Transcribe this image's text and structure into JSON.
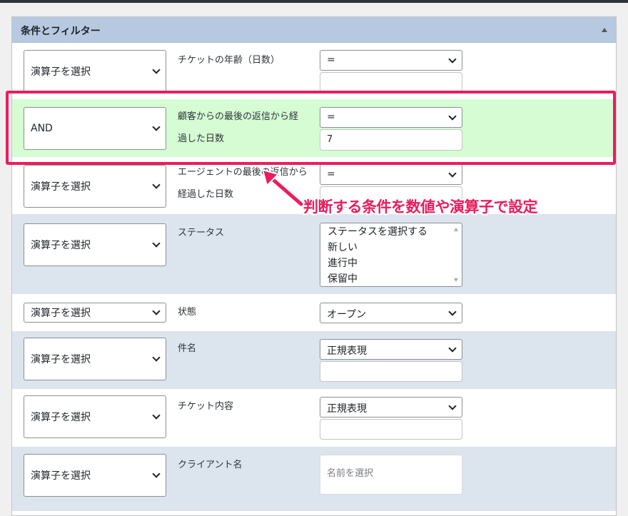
{
  "panel": {
    "title": "条件とフィルター"
  },
  "operator_placeholder": "演算子を選択",
  "rows": [
    {
      "operator": "演算子を選択",
      "label": "チケットの年齢（日数）",
      "comparator": "=",
      "value": ""
    },
    {
      "operator": "AND",
      "label_line1": "顧客からの最後の返信から経",
      "label_line2": "過した日数",
      "comparator": "=",
      "value": "7"
    },
    {
      "operator": "演算子を選択",
      "label_line1": "エージェントの最後の返信から",
      "label_line2": "経過した日数",
      "comparator": "=",
      "value": ""
    },
    {
      "operator": "演算子を選択",
      "label": "ステータス",
      "options": [
        "ステータスを選択する",
        "新しい",
        "進行中",
        "保留中"
      ]
    },
    {
      "operator": "演算子を選択",
      "label": "状態",
      "selected": "オープン"
    },
    {
      "operator": "演算子を選択",
      "label": "件名",
      "comparator": "正規表現",
      "value": ""
    },
    {
      "operator": "演算子を選択",
      "label": "チケット内容",
      "comparator": "正規表現",
      "value": ""
    },
    {
      "operator": "演算子を選択",
      "label": "クライアント名",
      "placeholder": "名前を選択"
    }
  ],
  "annotation": {
    "text": "判断する条件を数値や演算子で設定",
    "color": "#ec1c5d"
  },
  "colors": {
    "header": "#b7c9e0",
    "row_alt": "#dce4ee",
    "row_highlight": "#d6fcd4",
    "accent": "#ec1c5d"
  }
}
